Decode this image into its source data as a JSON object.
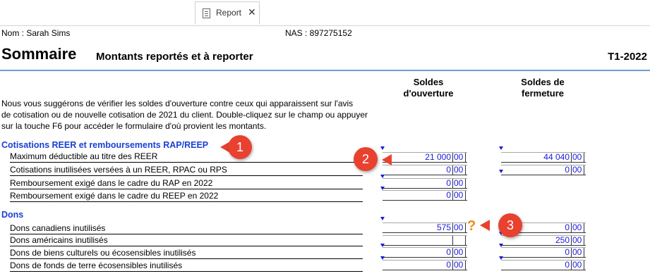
{
  "tab": {
    "label": "Report",
    "icon": "document-icon",
    "close_icon": "close-icon"
  },
  "header": {
    "name": "Nom : Sarah Sims",
    "nas": "NAS : 897275152",
    "title": "Sommaire",
    "subtitle": "Montants reportés et à reporter",
    "year": "T1-2022"
  },
  "columns": {
    "opening_line1": "Soldes",
    "opening_line2": "d'ouverture",
    "closing_line1": "Soldes de",
    "closing_line2": "fermeture"
  },
  "intro": {
    "line1": "Nous vous suggérons de vérifier les soldes d'ouverture contre ceux qui apparaissent sur l'avis",
    "line2": "de cotisation ou de nouvelle cotisation de 2021 du client. Double-cliquez sur le champ ou appuyer",
    "line3": "sur la touche F6 pour accéder le formulaire d'où provient les montants."
  },
  "sections": {
    "reer": {
      "title": "Cotisations REER et remboursements RAP/REEP",
      "rows": [
        {
          "label": "Maximum déductible au titre des REER",
          "open": "21 000",
          "open_c": "00",
          "close": "44 040",
          "close_c": "00"
        },
        {
          "label": "Cotisations inutilisées versées à un REER, RPAC ou RPS",
          "open": "0",
          "open_c": "00",
          "close": "0",
          "close_c": "00"
        },
        {
          "label": "Remboursement exigé dans le cadre du RAP en 2022",
          "open": "0",
          "open_c": "00"
        },
        {
          "label": "Remboursement exigé dans le cadre du REEP en 2022",
          "open": "0",
          "open_c": "00"
        }
      ]
    },
    "dons": {
      "title": "Dons",
      "rows": [
        {
          "label": "Dons canadiens inutilisés",
          "open": "575",
          "open_c": "00",
          "close": "0",
          "close_c": "00"
        },
        {
          "label": "Dons américains inutilisés",
          "open": "",
          "open_c": "",
          "close": "250",
          "close_c": "00"
        },
        {
          "label": "Dons de biens culturels ou écosensibles inutilisés",
          "open": "0",
          "open_c": "00",
          "close": "0",
          "close_c": "00"
        },
        {
          "label": "Dons de fonds de terre écosensibles inutilisés",
          "open": "0",
          "open_c": "00",
          "close": "0",
          "close_c": "00"
        }
      ]
    }
  },
  "callouts": [
    "1",
    "2",
    "3"
  ],
  "question_mark": "?",
  "colors": {
    "section_title": "#1a3fd4",
    "field_text": "#1a1adb",
    "callout": "#e8412f",
    "rule": "#6b9fd1",
    "question": "#f08a1c"
  }
}
